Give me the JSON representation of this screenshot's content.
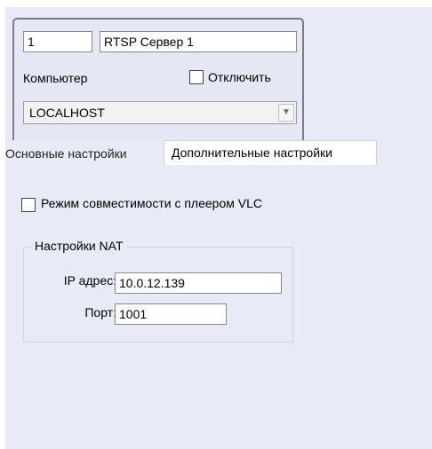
{
  "object": {
    "id": "1",
    "name": "RTSP Сервер 1",
    "computer_label": "Компьютер",
    "disable_label": "Отключить",
    "disable_checked": false,
    "computer_value": "LOCALHOST",
    "dropdown_icon": "chevron-down-icon"
  },
  "tabs": [
    {
      "label": "Основные настройки",
      "active": false
    },
    {
      "label": "Дополнительные настройки",
      "active": true
    }
  ],
  "settings": {
    "vlc_label": "Режим совместимости с плеером VLC",
    "vlc_checked": false,
    "nat": {
      "title": "Настройки NAT",
      "ip_label": "IP адрес:",
      "ip_value": "10.0.12.139",
      "port_label": "Порт:",
      "port_value": "1001"
    }
  },
  "colors": {
    "panel_bg": "#e9eaf8",
    "object_box_border": "#7b7c85"
  }
}
